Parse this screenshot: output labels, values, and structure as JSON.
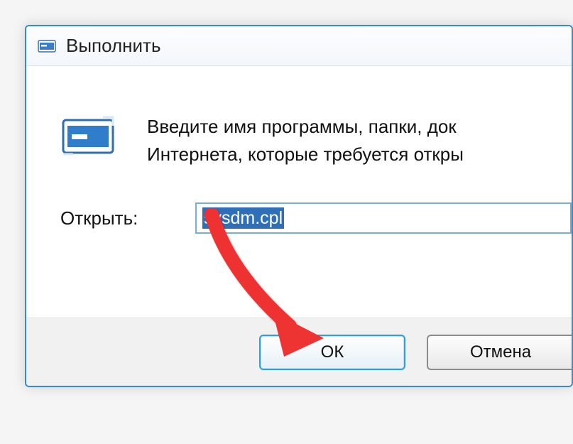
{
  "dialog": {
    "title": "Выполнить",
    "description": "Введите имя программы, папки, док\nИнтернета, которые требуется откры",
    "open_label": "Открыть:",
    "input_value": "sysdm.cpl",
    "buttons": {
      "ok": "ОК",
      "cancel": "Отмена"
    }
  }
}
